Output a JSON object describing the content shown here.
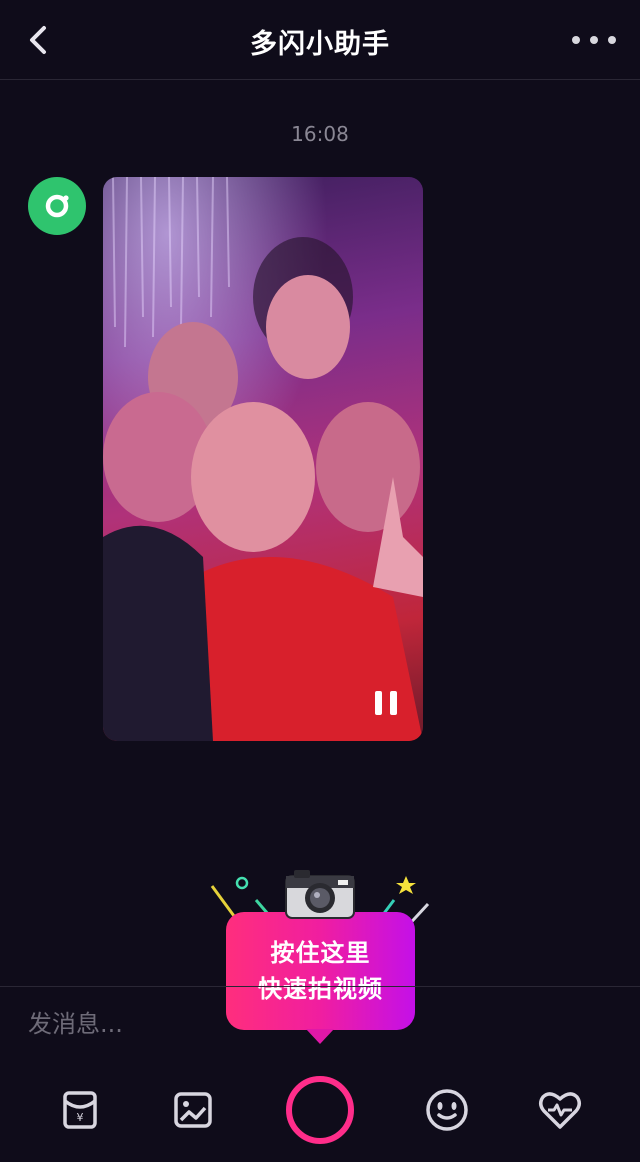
{
  "header": {
    "title": "多闪小助手",
    "back_icon": "chevron-left-icon",
    "more_icon": "more-dots-icon"
  },
  "chat": {
    "timestamp": "16:08",
    "sender_avatar_icon": "duoshan-assistant-avatar",
    "message": {
      "type": "video",
      "thumbnail": "group selfie photo",
      "state_icon": "pause-icon"
    }
  },
  "tooltip": {
    "line1": "按住这里",
    "line2": "快速拍视频",
    "icon": "camera-icon"
  },
  "composer": {
    "placeholder": "发消息..."
  },
  "toolbar": {
    "items": [
      {
        "icon": "red-packet-icon"
      },
      {
        "icon": "image-icon"
      },
      {
        "icon": "record-button"
      },
      {
        "icon": "emoji-icon"
      },
      {
        "icon": "heart-icon"
      }
    ]
  },
  "colors": {
    "background": "#0f0c1a",
    "accent_pink": "#ff2d8a",
    "avatar_green": "#2fc46e",
    "tooltip_start": "#ff2e7d",
    "tooltip_end": "#c410e8"
  }
}
